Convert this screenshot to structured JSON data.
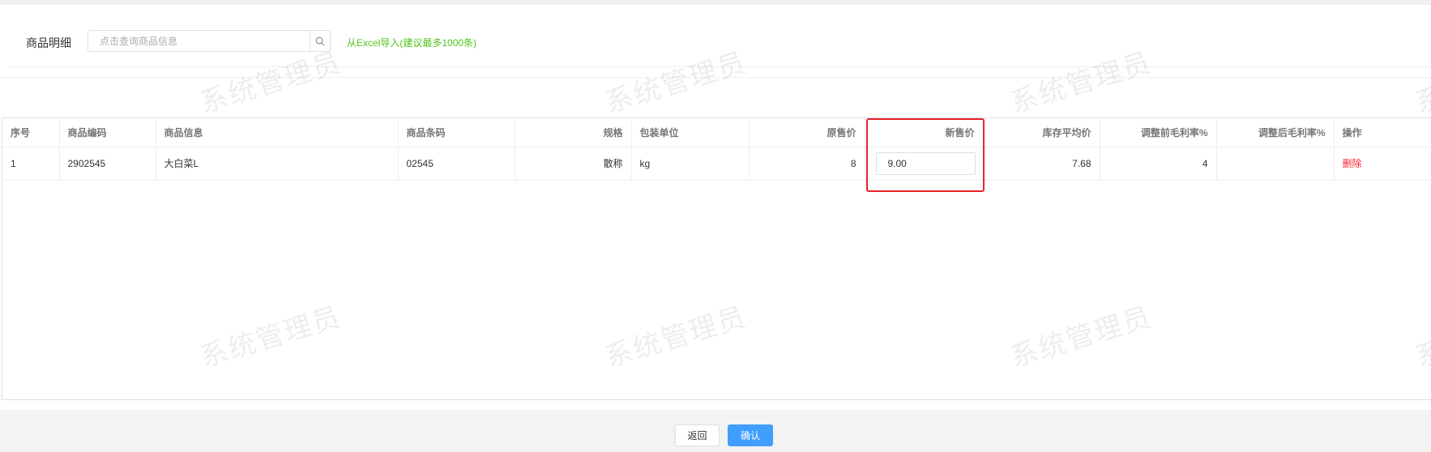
{
  "header": {
    "title": "商品明细",
    "search_placeholder": "点击查询商品信息",
    "import_link": "从Excel导入(建议最多1000条)"
  },
  "table": {
    "columns": [
      "序号",
      "商品编码",
      "商品信息",
      "商品条码",
      "规格",
      "包装单位",
      "原售价",
      "新售价",
      "库存平均价",
      "调整前毛利率%",
      "调整后毛利率%",
      "操作"
    ],
    "rows": [
      {
        "index": "1",
        "code": "2902545",
        "info": "大白菜L",
        "barcode": "02545",
        "spec": "散称",
        "unit": "kg",
        "orig_price": "8",
        "new_price": "9.00",
        "avg_cost": "7.68",
        "margin_before": "4",
        "margin_after": "",
        "action": "删除"
      }
    ]
  },
  "footer": {
    "back_label": "返回",
    "confirm_label": "确认"
  },
  "watermark": "系统管理员",
  "colors": {
    "accent": "#409eff",
    "success_link": "#52c41a",
    "danger": "#f5222d",
    "highlight": "#e8222a"
  }
}
